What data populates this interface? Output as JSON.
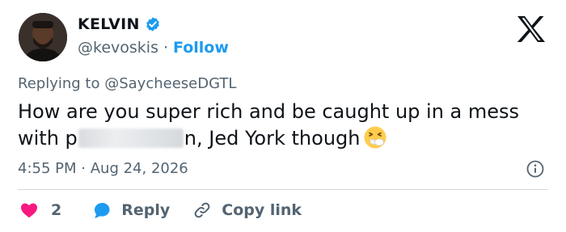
{
  "author": {
    "name": "KELVIN",
    "handle": "@kevoskis",
    "separator": "·",
    "follow_label": "Follow"
  },
  "reply": {
    "prefix": "Replying to",
    "mention": "@SaycheeseDGTL"
  },
  "tweet": {
    "text_part1": "How are you super rich and be caught up in a mess with p",
    "text_part2": "n, Jed York though"
  },
  "meta": {
    "time": "4:55 PM",
    "separator": "·",
    "date": "Aug 24, 2026"
  },
  "actions": {
    "like_count": "2",
    "reply_label": "Reply",
    "copy_label": "Copy link"
  },
  "colors": {
    "accent": "#1d9bf0",
    "like": "#f91880",
    "text": "#0f1419",
    "muted": "#536471"
  },
  "icons": {
    "verified": "verified-badge-icon",
    "brand": "x-logo-icon",
    "info": "info-icon",
    "like": "heart-icon",
    "reply": "reply-bubble-icon",
    "copy": "link-icon",
    "emoji": "sneezing-face-emoji"
  }
}
